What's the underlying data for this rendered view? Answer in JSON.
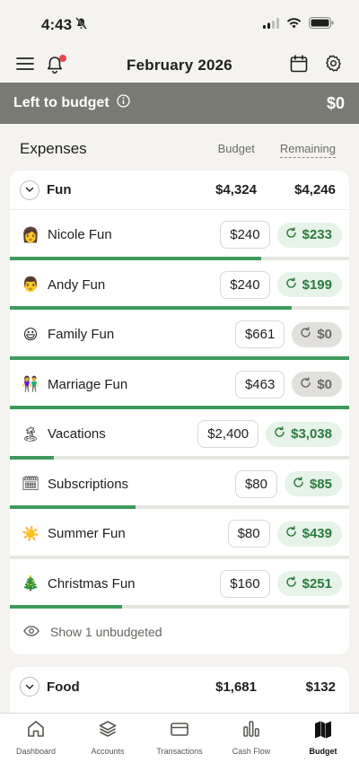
{
  "status": {
    "time": "4:43"
  },
  "nav": {
    "title": "February 2026"
  },
  "banner": {
    "label": "Left to budget",
    "amount": "$0"
  },
  "section": {
    "title": "Expenses",
    "col_budget": "Budget",
    "col_remaining": "Remaining"
  },
  "groups": [
    {
      "name": "Fun",
      "budget": "$4,324",
      "remaining": "$4,246",
      "categories": [
        {
          "emoji": "👩",
          "name": "Nicole Fun",
          "budget": "$240",
          "remaining": "$233",
          "status": "green",
          "progress": 0.74
        },
        {
          "emoji": "👨",
          "name": "Andy Fun",
          "budget": "$240",
          "remaining": "$199",
          "status": "green",
          "progress": 0.83
        },
        {
          "emoji": "😃",
          "name": "Family Fun",
          "budget": "$661",
          "remaining": "$0",
          "status": "grey",
          "progress": 1.0
        },
        {
          "emoji": "👫",
          "name": "Marriage Fun",
          "budget": "$463",
          "remaining": "$0",
          "status": "grey",
          "progress": 1.0
        },
        {
          "emoji": "🏝",
          "name": "Vacations",
          "budget": "$2,400",
          "remaining": "$3,038",
          "status": "green",
          "progress": 0.13
        },
        {
          "emoji": "🗓",
          "name": "Subscriptions",
          "budget": "$80",
          "remaining": "$85",
          "status": "green",
          "progress": 0.37
        },
        {
          "emoji": "☀️",
          "name": "Summer Fun",
          "budget": "$80",
          "remaining": "$439",
          "status": "green",
          "progress": 0.0
        },
        {
          "emoji": "🎄",
          "name": "Christmas Fun",
          "budget": "$160",
          "remaining": "$251",
          "status": "green",
          "progress": 0.33
        }
      ],
      "show_more": "Show 1 unbudgeted"
    },
    {
      "name": "Food",
      "budget": "$1,681",
      "remaining": "$132"
    }
  ],
  "tabs": [
    {
      "label": "Dashboard",
      "icon": "home-icon"
    },
    {
      "label": "Accounts",
      "icon": "layers-icon"
    },
    {
      "label": "Transactions",
      "icon": "card-icon"
    },
    {
      "label": "Cash Flow",
      "icon": "bar-chart-icon"
    },
    {
      "label": "Budget",
      "icon": "map-icon",
      "active": true
    }
  ],
  "colors": {
    "banner": "#7a7a75",
    "progress": "#3f9a5a",
    "pill_green_bg": "#e6f3e8",
    "pill_green_text": "#2d7a3e"
  }
}
